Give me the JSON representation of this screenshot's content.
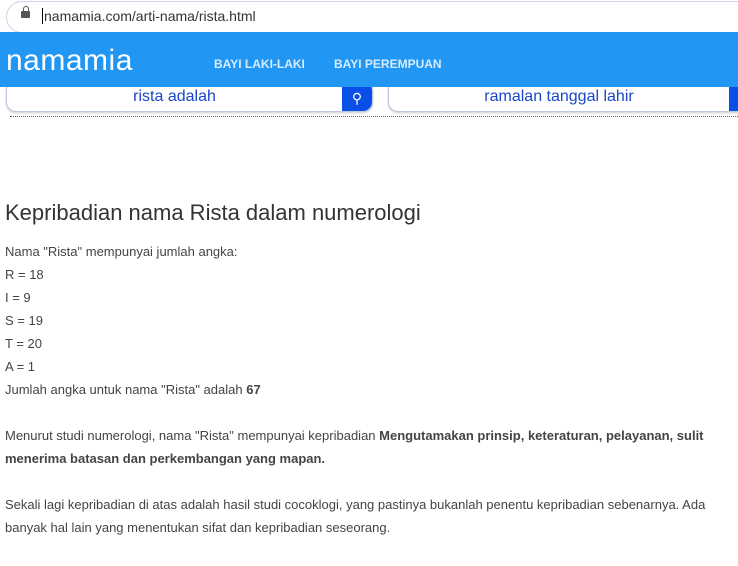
{
  "browser": {
    "url": "namamia.com/arti-nama/rista.html"
  },
  "header": {
    "logo": "namamia",
    "nav": [
      "BAYI LAKI-LAKI",
      "BAYI PEREMPUAN"
    ],
    "color": "#2196f3"
  },
  "search": [
    "rista adalah",
    "ramalan tanggal lahir"
  ],
  "article": {
    "title": "Kepribadian nama Rista dalam numerologi",
    "intro": "Nama \"Rista\" mempunyai jumlah angka:",
    "letters": [
      "R = 18",
      "I = 9",
      "S = 19",
      "T = 20",
      "A = 1"
    ],
    "total_prefix": "Jumlah angka untuk nama \"Rista\" adalah ",
    "total": "67",
    "personality_prefix": "Menurut studi numerologi, nama \"Rista\" mempunyai kepribadian ",
    "personality": "Mengutamakan prinsip, keteraturan, pelayanan, sulit menerima batasan dan perkembangan yang mapan.",
    "disclaimer": "Sekali lagi kepribadian di atas adalah hasil studi cocoklogi, yang pastinya bukanlah penentu kepribadian sebenarnya. Ada banyak hal lain yang menentukan sifat dan kepribadian seseorang."
  }
}
